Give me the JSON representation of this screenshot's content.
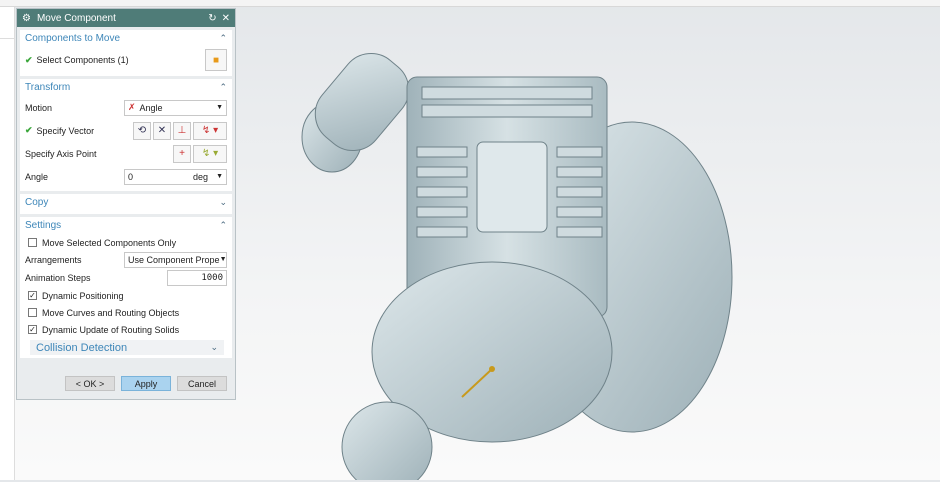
{
  "dialog": {
    "title": "Move Component",
    "components_section": {
      "title": "Components to Move",
      "select_label": "Select Components (1)"
    },
    "transform_section": {
      "title": "Transform",
      "motion_label": "Motion",
      "motion_value": "Angle",
      "vector_label": "Specify Vector",
      "axis_point_label": "Specify Axis Point",
      "angle_label": "Angle",
      "angle_value": "0",
      "angle_unit": "deg"
    },
    "copy_section": {
      "title": "Copy"
    },
    "settings_section": {
      "title": "Settings",
      "move_selected_only": {
        "label": "Move Selected Components Only",
        "checked": false
      },
      "arrangements_label": "Arrangements",
      "arrangements_value": "Use Component Prope",
      "animation_steps_label": "Animation Steps",
      "animation_steps_value": "1000",
      "dynamic_positioning": {
        "label": "Dynamic Positioning",
        "checked": true
      },
      "move_curves": {
        "label": "Move Curves and Routing Objects",
        "checked": false
      },
      "dynamic_update": {
        "label": "Dynamic Update of Routing Solids",
        "checked": true
      },
      "collision_detection": "Collision Detection"
    },
    "buttons": {
      "ok": "< OK >",
      "apply": "Apply",
      "cancel": "Cancel"
    }
  },
  "colors": {
    "header": "#4f7c78",
    "section_title": "#3d86b8",
    "check": "#3aa63a",
    "model": "#c5d3d8"
  }
}
